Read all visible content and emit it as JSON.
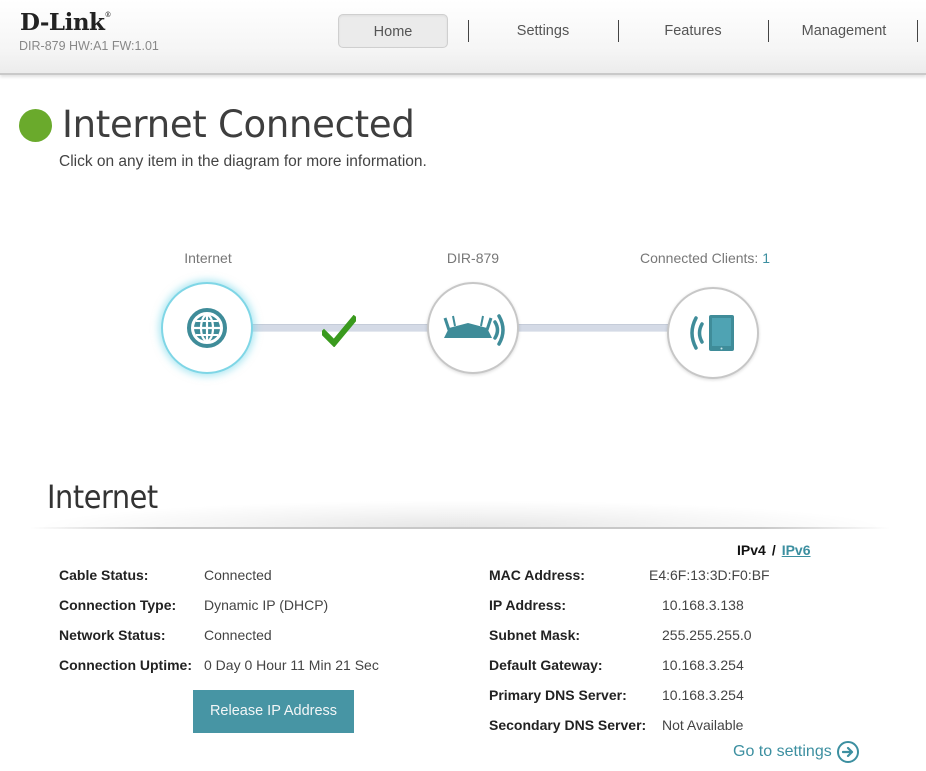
{
  "header": {
    "brand": "D-Link",
    "brand_mark": "®",
    "model_info": "DIR-879 HW:A1 FW:1.01",
    "nav": [
      {
        "label": "Home",
        "active": true
      },
      {
        "label": "Settings",
        "active": false
      },
      {
        "label": "Features",
        "active": false
      },
      {
        "label": "Management",
        "active": false
      }
    ]
  },
  "status": {
    "title": "Internet Connected",
    "subtitle": "Click on any item in the diagram for more information.",
    "indicator_color": "#6aaa2c"
  },
  "diagram": {
    "internet_label": "Internet",
    "router_label": "DIR-879",
    "clients_label": "Connected Clients:",
    "clients_count": "1",
    "internet_icon": "globe-icon",
    "router_icon": "router-icon",
    "clients_icon": "tablet-wireless-icon",
    "link_status_icon": "checkmark-icon"
  },
  "internet": {
    "section_title": "Internet",
    "ip_versions": {
      "ipv4": "IPv4",
      "separator": "/",
      "ipv6": "IPv6"
    },
    "left": [
      {
        "label": "Cable Status:",
        "value": "Connected"
      },
      {
        "label": "Connection Type:",
        "value": "Dynamic IP (DHCP)"
      },
      {
        "label": "Network Status:",
        "value": "Connected"
      },
      {
        "label": "Connection Uptime:",
        "value": "0 Day 0 Hour 11 Min 21 Sec"
      }
    ],
    "right": [
      {
        "label": "MAC Address:",
        "value": "E4:6F:13:3D:F0:BF"
      },
      {
        "label": "IP Address:",
        "value": "10.168.3.138"
      },
      {
        "label": "Subnet Mask:",
        "value": "255.255.255.0"
      },
      {
        "label": "Default Gateway:",
        "value": "10.168.3.254"
      },
      {
        "label": "Primary DNS Server:",
        "value": "10.168.3.254"
      },
      {
        "label": "Secondary DNS Server:",
        "value": "Not Available"
      }
    ],
    "release_button": "Release IP Address",
    "goto_settings": "Go to settings"
  },
  "colors": {
    "accent": "#3c8fa0",
    "button": "#4795a4",
    "connected": "#6aaa2c"
  }
}
